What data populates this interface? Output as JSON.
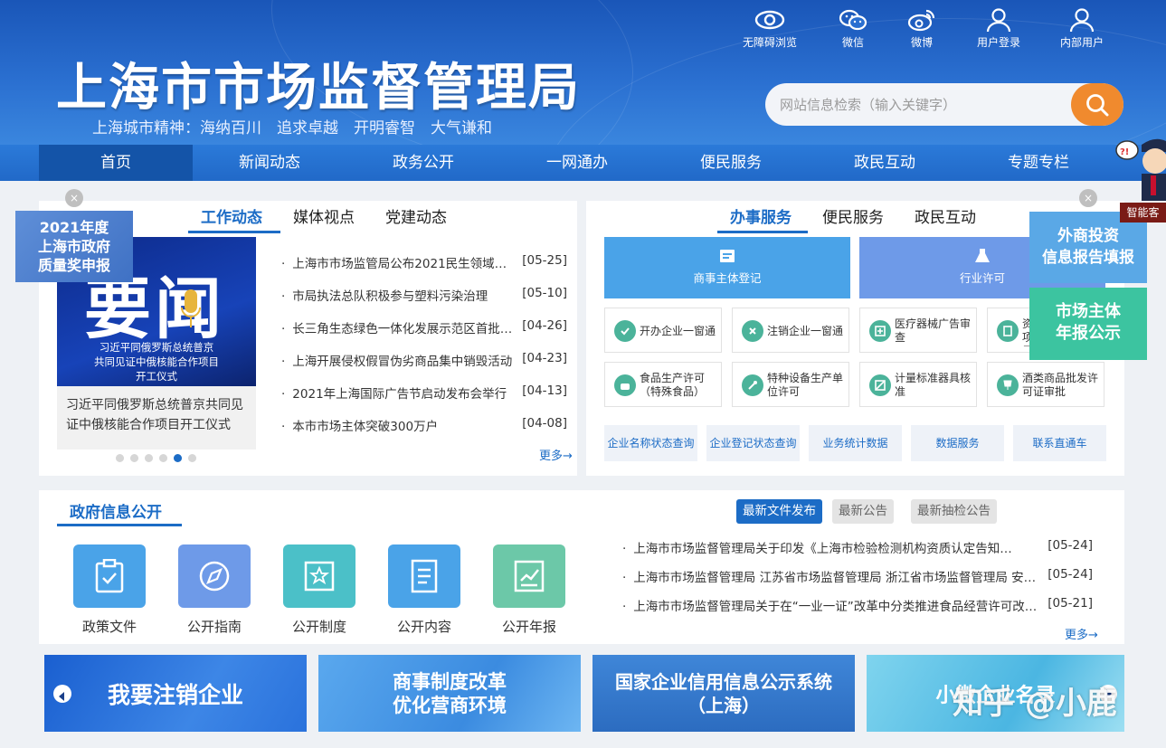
{
  "header": {
    "title": "上海市市场监督管理局",
    "motto": "上海城市精神：海纳百川　追求卓越　开明睿智　大气谦和",
    "top_links": [
      {
        "label": "无障碍浏览",
        "icon": "eye-icon"
      },
      {
        "label": "微信",
        "icon": "wechat-icon"
      },
      {
        "label": "微博",
        "icon": "weibo-icon"
      },
      {
        "label": "用户登录",
        "icon": "user-icon"
      },
      {
        "label": "内部用户",
        "icon": "user-icon"
      }
    ],
    "search_placeholder": "网站信息检索（输入关键字）"
  },
  "nav": {
    "items": [
      "首页",
      "新闻动态",
      "政务公开",
      "一网通办",
      "便民服务",
      "政民互动",
      "专题专栏"
    ],
    "active": "首页"
  },
  "news": {
    "tabs": [
      "工作动态",
      "媒体视点",
      "党建动态"
    ],
    "active_tab": "工作动态",
    "feature_image_big_text": "要闻",
    "feature_image_overlay": "习近平同俄罗斯总统普京\n共同见证中俄核能合作项目\n开工仪式",
    "feature_caption": "习近平同俄罗斯总统普京共同见证中俄核能合作项目开工仪式",
    "items": [
      {
        "title": "上海市市场监管局公布2021民生领域…",
        "date": "[05-25]"
      },
      {
        "title": "市局执法总队积极参与塑料污染治理",
        "date": "[05-10]"
      },
      {
        "title": "长三角生态绿色一体化发展示范区首批…",
        "date": "[04-26]"
      },
      {
        "title": "上海开展侵权假冒伪劣商品集中销毁活动",
        "date": "[04-23]"
      },
      {
        "title": "2021年上海国际广告节启动发布会举行",
        "date": "[04-13]"
      },
      {
        "title": "本市市场主体突破300万户",
        "date": "[04-08]"
      }
    ],
    "more": "更多→",
    "carousel_pages": 6,
    "carousel_active": 5
  },
  "left_float": {
    "label": "2021年度\n上海市政府\n质量奖申报",
    "close": "×"
  },
  "service": {
    "tabs": [
      "办事服务",
      "便民服务",
      "政民互动"
    ],
    "active_tab": "办事服务",
    "big_tiles": [
      {
        "label": "商事主体登记",
        "icon": "document-icon",
        "color": "#4aa3e8"
      },
      {
        "label": "行业许可",
        "icon": "flask-icon",
        "color": "#6e9ae8"
      }
    ],
    "tiles": [
      {
        "label": "开办企业一窗通",
        "icon": "check-icon"
      },
      {
        "label": "注销企业一窗通",
        "icon": "cancel-icon"
      },
      {
        "label": "医疗器械广告审查",
        "icon": "medical-icon"
      },
      {
        "label": "企业投资项目核准",
        "icon": "document-icon"
      },
      {
        "label": "食品生产许可（特殊食品）",
        "icon": "food-icon"
      },
      {
        "label": "特种设备生产单位许可",
        "icon": "wrench-icon"
      },
      {
        "label": "计量标准器具核准",
        "icon": "ruler-icon"
      },
      {
        "label": "酒类商品批发许可证审批",
        "icon": "cup-icon"
      }
    ],
    "quick_links": [
      "企业名称状态查询",
      "企业登记状态查询",
      "业务统计数据",
      "数据服务",
      "联系直通车"
    ]
  },
  "right_floats": [
    {
      "label": "外商投资\n信息报告填报",
      "color": "#5aa8e6"
    },
    {
      "label": "市场主体\n年报公示",
      "color": "#3cc4a0"
    }
  ],
  "assistant": {
    "label": "智能客"
  },
  "gov_info": {
    "title": "政府信息公开",
    "icons": [
      {
        "label": "政策文件",
        "icon": "clipboard-icon",
        "color": "#4aa3e8"
      },
      {
        "label": "公开指南",
        "icon": "compass-icon",
        "color": "#6e9ae8"
      },
      {
        "label": "公开制度",
        "icon": "star-frame-icon",
        "color": "#4bc0c8"
      },
      {
        "label": "公开内容",
        "icon": "document-icon",
        "color": "#4aa3e8"
      },
      {
        "label": "公开年报",
        "icon": "chart-icon",
        "color": "#6cc8a8"
      }
    ],
    "pills": [
      "最新文件发布",
      "最新公告",
      "最新抽检公告"
    ],
    "active_pill": "最新文件发布",
    "notices": [
      {
        "title": "上海市市场监督管理局关于印发《上海市检验检测机构资质认定告知…",
        "date": "[05-24]"
      },
      {
        "title": "上海市市场监督管理局 江苏省市场监督管理局 浙江省市场监督管理局 安…",
        "date": "[05-24]"
      },
      {
        "title": "上海市市场监督管理局关于在“一业一证”改革中分类推进食品经营许可改…",
        "date": "[05-21]"
      }
    ],
    "more": "更多→"
  },
  "banners": [
    {
      "label": "我要注销企业"
    },
    {
      "label": "商事制度改革\n优化营商环境"
    },
    {
      "label": "国家企业信用信息公示系统\n（上海）"
    },
    {
      "label": "小微企业名录"
    }
  ],
  "watermark": "知乎 @小鹿"
}
